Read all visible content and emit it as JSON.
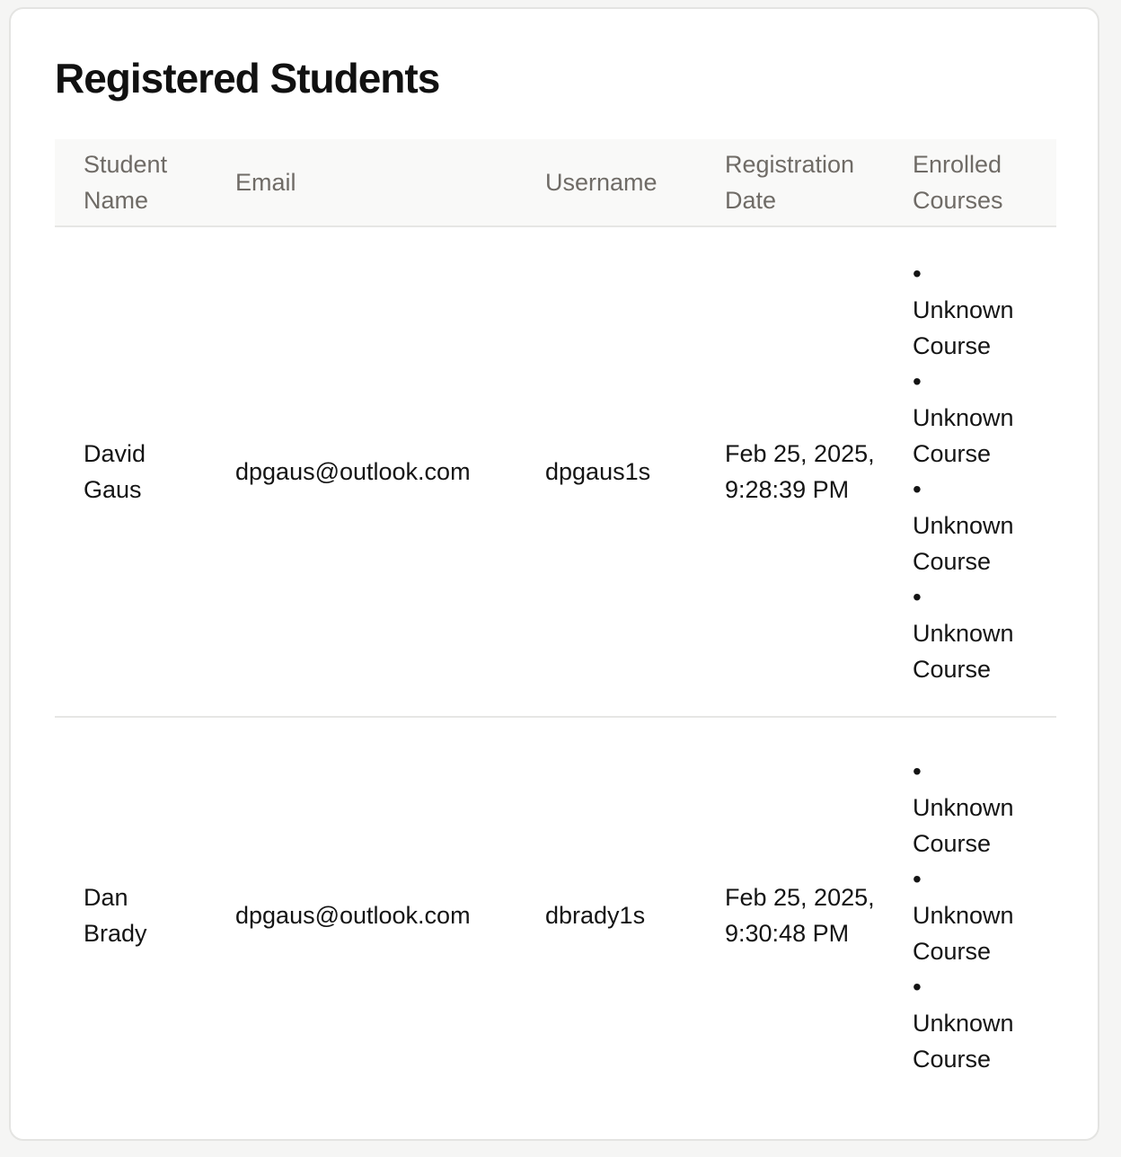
{
  "page": {
    "title": "Registered Students"
  },
  "table": {
    "headers": {
      "name": "Student Name",
      "email": "Email",
      "username": "Username",
      "registration_date": "Registration Date",
      "enrolled_courses": "Enrolled Courses"
    },
    "rows": [
      {
        "name": "David Gaus",
        "email": "dpgaus@outlook.com",
        "username": "dpgaus1s",
        "registration_date": "Feb 25, 2025, 9:28:39 PM",
        "courses": [
          "Unknown Course",
          "Unknown Course",
          "Unknown Course",
          "Unknown Course"
        ]
      },
      {
        "name": "Dan Brady",
        "email": "dpgaus@outlook.com",
        "username": "dbrady1s",
        "registration_date": "Feb 25, 2025, 9:30:48 PM",
        "courses": [
          "Unknown Course",
          "Unknown Course",
          "Unknown Course"
        ]
      }
    ]
  },
  "glyphs": {
    "bullet": "•"
  }
}
